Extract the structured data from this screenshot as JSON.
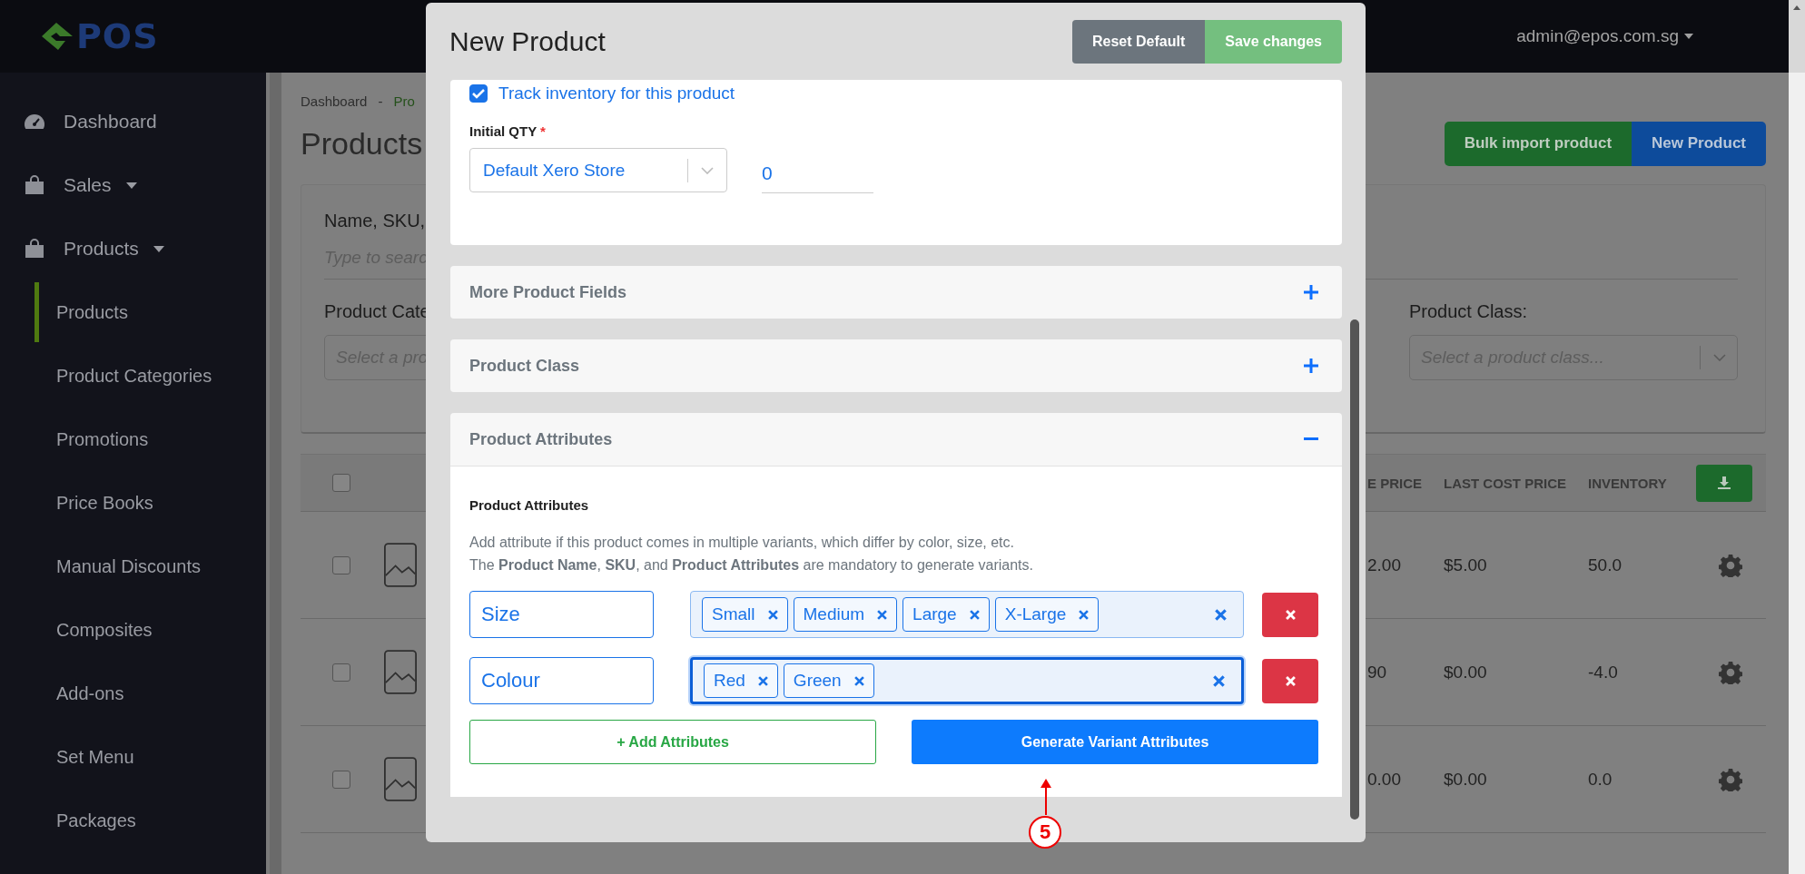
{
  "header": {
    "logo_text": "POS",
    "user": "admin@epos.com.sg"
  },
  "sidebar": {
    "items": [
      {
        "label": "Dashboard",
        "kind": "link"
      },
      {
        "label": "Sales",
        "kind": "group"
      },
      {
        "label": "Products",
        "kind": "group",
        "children": [
          {
            "label": "Products",
            "selected": true
          },
          {
            "label": "Product Categories",
            "selected": false
          },
          {
            "label": "Promotions",
            "selected": false
          },
          {
            "label": "Price Books",
            "selected": false
          },
          {
            "label": "Manual Discounts",
            "selected": false
          },
          {
            "label": "Composites",
            "selected": false
          },
          {
            "label": "Add-ons",
            "selected": false
          },
          {
            "label": "Set Menu",
            "selected": false
          },
          {
            "label": "Packages",
            "selected": false
          }
        ]
      }
    ]
  },
  "breadcrumb": [
    "Dashboard",
    "-",
    "Pro"
  ],
  "page_title": "Products",
  "actions": [
    {
      "label": "Bulk import product",
      "kind": "success"
    },
    {
      "label": "New Product",
      "kind": "primary"
    }
  ],
  "filters": {
    "search_label": "Name, SKU,",
    "search_placeholder": "Type to searc",
    "category_label": "Product Cate",
    "category_placeholder": "Select a pro",
    "class_label": "Product Class:",
    "class_placeholder": "Select a product class..."
  },
  "table": {
    "select_all_checked": false,
    "columns": [
      "E PRICE",
      "LAST COST PRICE",
      "INVENTORY"
    ],
    "rows": [
      {
        "checked": false,
        "cells": [
          "2.00",
          "$5.00",
          "50.0"
        ]
      },
      {
        "checked": false,
        "cells": [
          "90",
          "$0.00",
          "-4.0"
        ]
      },
      {
        "checked": false,
        "cells": [
          "0.00",
          "$0.00",
          "0.0"
        ]
      }
    ]
  },
  "modal": {
    "title": "New Product",
    "buttons": [
      {
        "label": "Reset Default",
        "kind": "secondary"
      },
      {
        "label": "Save changes",
        "kind": "success"
      }
    ],
    "track_inventory": {
      "label": "Track inventory for this product",
      "checked": true
    },
    "initial_qty": {
      "label": "Initial QTY",
      "required_mark": "*",
      "store": "Default Xero Store",
      "value": "0"
    },
    "sections": [
      {
        "title": "More Product Fields",
        "expanded": false
      },
      {
        "title": "Product Class",
        "expanded": false
      },
      {
        "title": "Product Attributes",
        "expanded": true
      }
    ],
    "attributes": {
      "heading": "Product Attributes",
      "description": [
        "Add attribute if this product comes in multiple variants, which differ by color, size, etc.",
        "The **Product Name**, **SKU**, and **Product Attributes** are mandatory to generate variants."
      ],
      "rows": [
        {
          "name": "Size",
          "values": [
            "Small",
            "Medium",
            "Large",
            "X-Large"
          ],
          "focused": false
        },
        {
          "name": "Colour",
          "values": [
            "Red",
            "Green"
          ],
          "focused": true
        }
      ],
      "add_button": "+ Add Attributes",
      "generate_button": "Generate Variant Attributes"
    }
  },
  "annotation": {
    "number": "5"
  }
}
